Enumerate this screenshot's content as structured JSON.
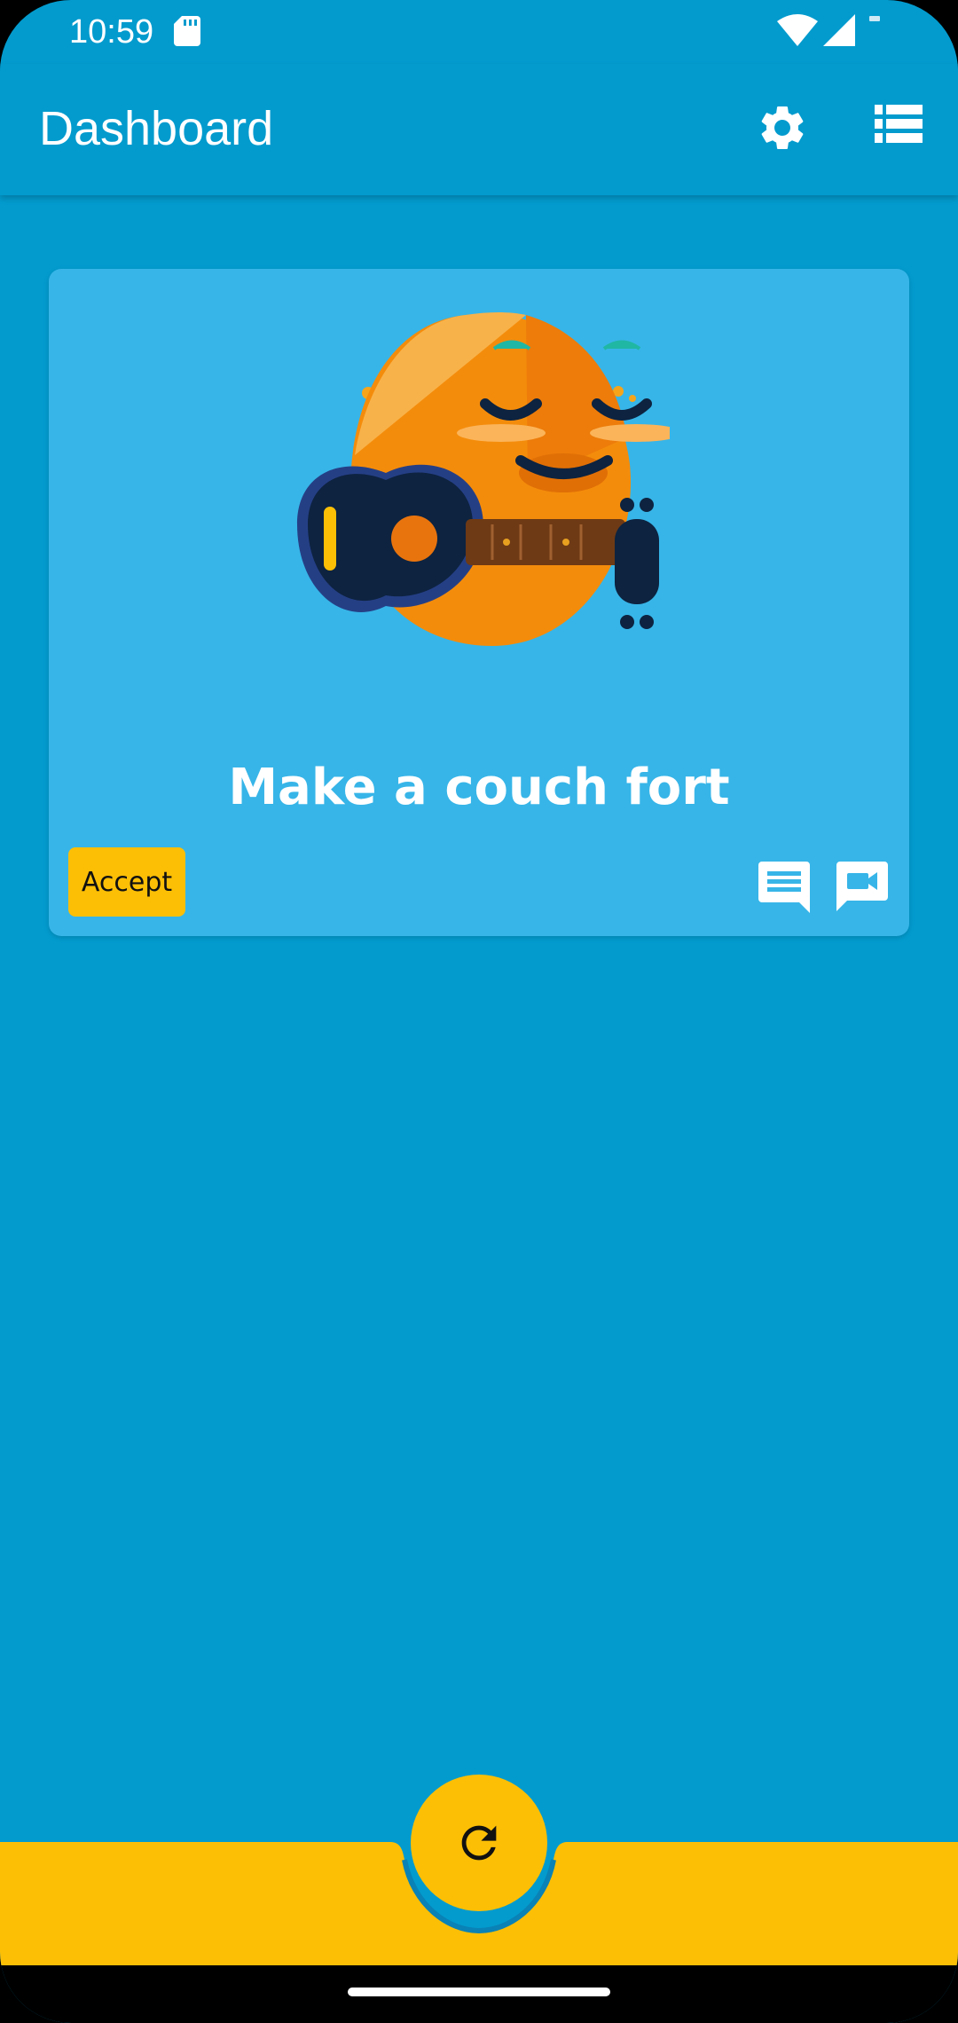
{
  "status_bar": {
    "time": "10:59",
    "icons": [
      "sd-card-icon",
      "wifi-icon",
      "signal-icon",
      "battery-icon"
    ]
  },
  "app_bar": {
    "title": "Dashboard",
    "actions": [
      "settings-icon",
      "list-icon"
    ]
  },
  "task_card": {
    "title": "Make a couch fort",
    "accept_label": "Accept",
    "illustration": "orange-character-with-guitar",
    "actions": [
      "chat-icon",
      "video-call-icon"
    ]
  },
  "bottom_bar": {
    "fab_icon": "refresh-icon"
  },
  "colors": {
    "background": "#039BCE",
    "card": "#37B5E8",
    "accent": "#FCBF06",
    "text": "#FFFFFF"
  }
}
